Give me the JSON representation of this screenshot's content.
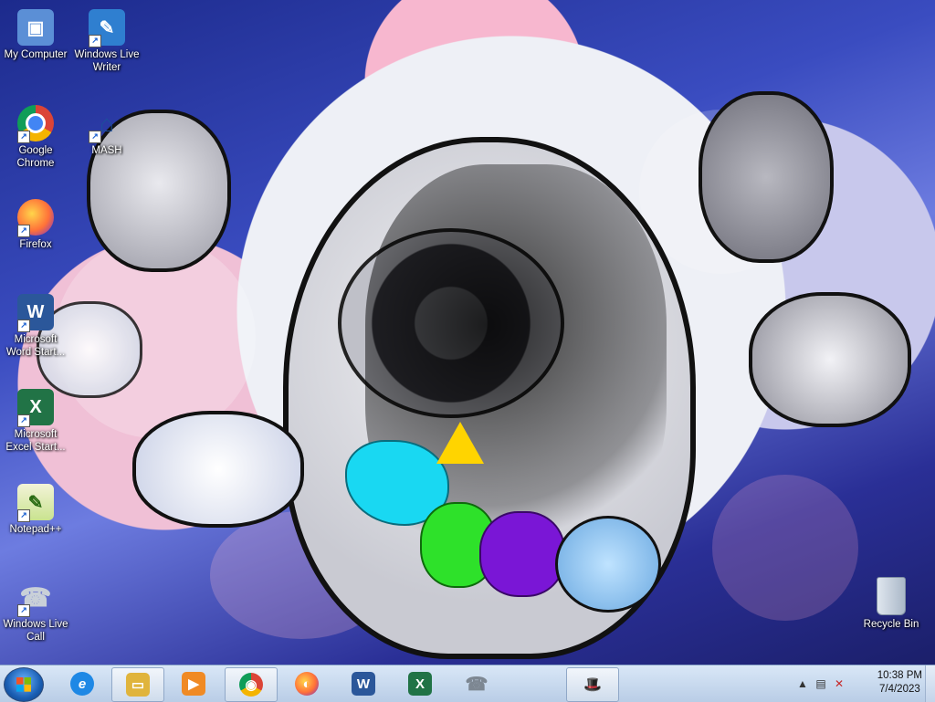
{
  "desktop_icons": [
    {
      "label": "My Computer",
      "icon": "computer-icon",
      "color": "#5b8fd6"
    },
    {
      "label": "Windows Live Writer",
      "icon": "writer-icon",
      "color": "#2f7fd0"
    },
    {
      "label": "Google Chrome",
      "icon": "chrome-icon",
      "color": "#db4437"
    },
    {
      "label": "MASH",
      "icon": "hat-icon",
      "color": "#1c4f9c"
    },
    {
      "label": "Firefox",
      "icon": "firefox-icon",
      "color": "#ff7139"
    },
    {
      "label": "Microsoft Word Start...",
      "icon": "word-icon",
      "color": "#2b579a"
    },
    {
      "label": "Microsoft Excel Start...",
      "icon": "excel-icon",
      "color": "#217346"
    },
    {
      "label": "Notepad++",
      "icon": "notepadpp-icon",
      "color": "#8bc34a"
    },
    {
      "label": "Windows Live Call",
      "icon": "phone-icon",
      "color": "#9aa3ad"
    },
    {
      "label": "Recycle Bin",
      "icon": "recycle-bin-icon",
      "color": "#aab8c8"
    }
  ],
  "taskbar": {
    "pinned": [
      {
        "name": "internet-explorer",
        "glyph": "e",
        "color": "#1e88e5"
      },
      {
        "name": "windows-explorer",
        "glyph": "▭",
        "color": "#e0b43c"
      },
      {
        "name": "media-player",
        "glyph": "▶",
        "color": "#f08a24"
      },
      {
        "name": "google-chrome",
        "glyph": "◉",
        "color": "#db4437"
      },
      {
        "name": "firefox",
        "glyph": "◐",
        "color": "#ff7139"
      },
      {
        "name": "microsoft-word",
        "glyph": "W",
        "color": "#2b579a"
      },
      {
        "name": "microsoft-excel",
        "glyph": "X",
        "color": "#217346"
      },
      {
        "name": "windows-live-call",
        "glyph": "☎",
        "color": "#7d8792"
      },
      {
        "name": "mash",
        "glyph": "🎩",
        "color": "#1c4f9c"
      }
    ],
    "clock": {
      "time": "10:38 PM",
      "date": "7/4/2023"
    }
  }
}
